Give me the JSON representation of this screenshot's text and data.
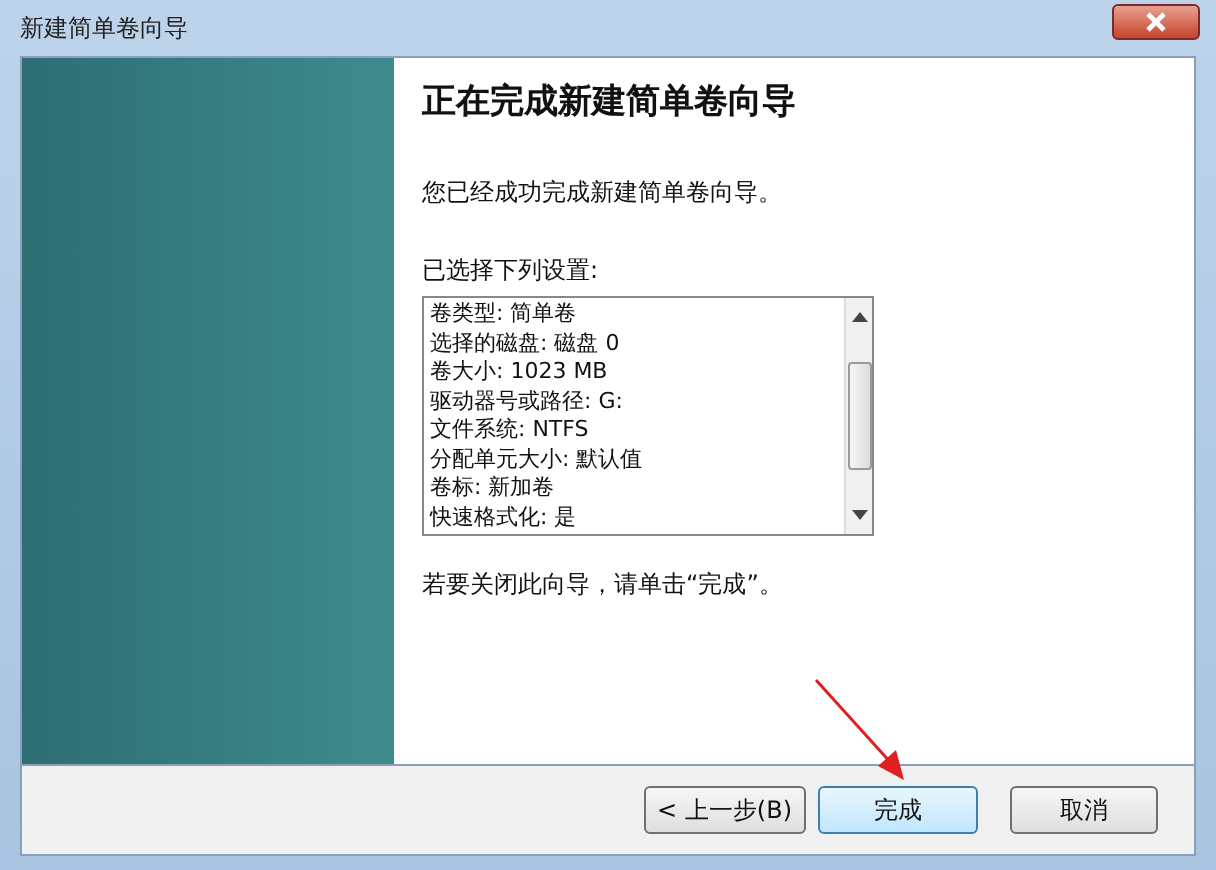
{
  "window": {
    "title": "新建简单卷向导"
  },
  "heading": "正在完成新建简单卷向导",
  "intro": "您已经成功完成新建简单卷向导。",
  "settings_label": "已选择下列设置:",
  "settings": [
    "卷类型: 简单卷",
    "选择的磁盘: 磁盘 0",
    "卷大小: 1023 MB",
    "驱动器号或路径: G:",
    "文件系统: NTFS",
    "分配单元大小: 默认值",
    "卷标: 新加卷",
    "快速格式化: 是"
  ],
  "close_hint": "若要关闭此向导，请单击“完成”。",
  "buttons": [
    {
      "label": "< 上一步(B)",
      "kind": "normal"
    },
    {
      "label": "完成",
      "kind": "default"
    },
    {
      "label": "取消",
      "kind": "cancel"
    }
  ]
}
